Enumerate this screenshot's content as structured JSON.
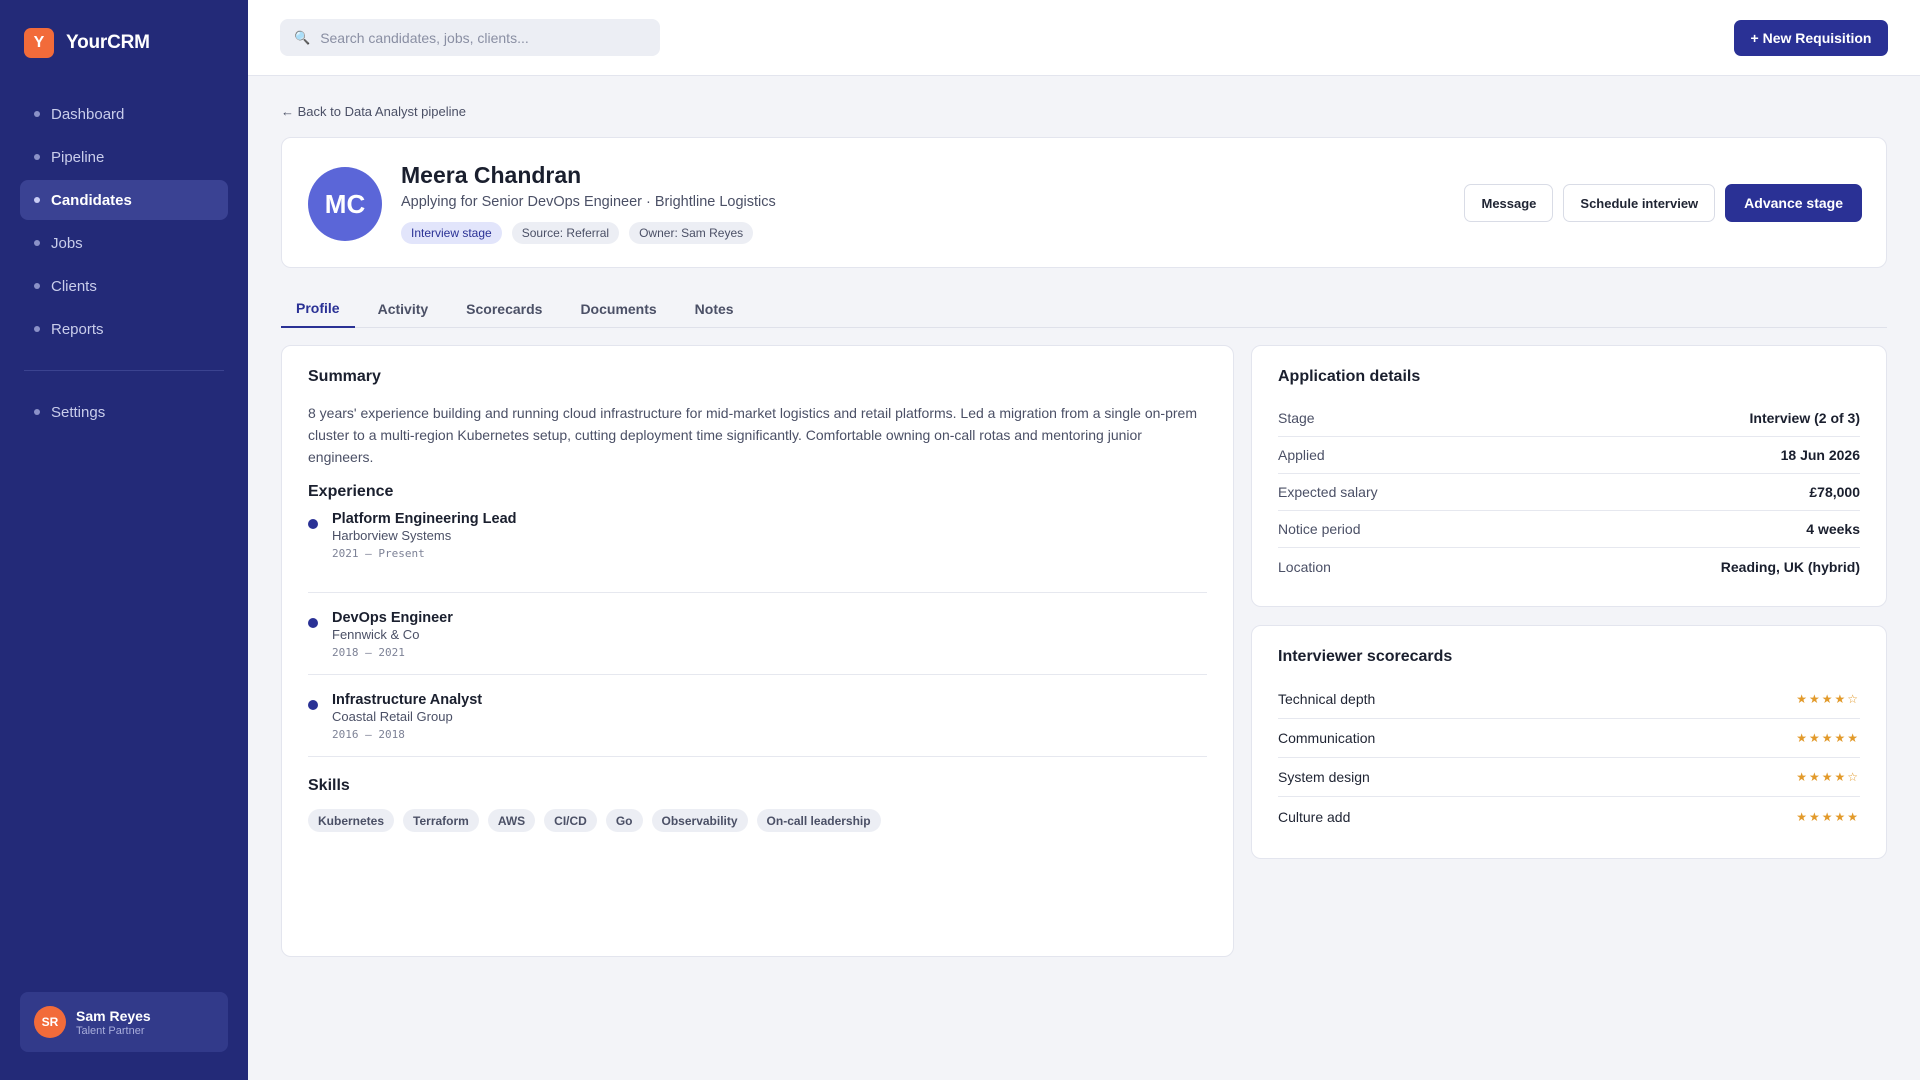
{
  "brand": {
    "logo_letter": "Y",
    "name": "YourCRM",
    "accent": "#f26b3a",
    "sidebar_bg": "#232a78"
  },
  "nav": {
    "items": [
      {
        "label": "Dashboard",
        "active": false
      },
      {
        "label": "Pipeline",
        "active": false
      },
      {
        "label": "Candidates",
        "active": true
      },
      {
        "label": "Jobs",
        "active": false
      },
      {
        "label": "Clients",
        "active": false
      },
      {
        "label": "Reports",
        "active": false
      }
    ],
    "settings": "Settings"
  },
  "user": {
    "initials": "SR",
    "name": "Sam Reyes",
    "role": "Talent Partner"
  },
  "search": {
    "placeholder": "Search candidates, jobs, clients...",
    "value": "",
    "icon": "search-icon"
  },
  "topbar": {
    "new_requisition": "+ New Requisition"
  },
  "back_link": "← Back to Data Analyst pipeline",
  "candidate": {
    "initials": "MC",
    "name": "Meera Chandran",
    "subtitle": "Applying for Senior DevOps Engineer · Brightline Logistics",
    "tags": [
      "Interview stage",
      "Source: Referral",
      "Owner: Sam Reyes"
    ]
  },
  "actions": {
    "message": "Message",
    "schedule": "Schedule interview",
    "advance": "Advance stage"
  },
  "tabs": [
    {
      "label": "Profile",
      "active": true
    },
    {
      "label": "Activity",
      "active": false
    },
    {
      "label": "Scorecards",
      "active": false
    },
    {
      "label": "Documents",
      "active": false
    },
    {
      "label": "Notes",
      "active": false
    }
  ],
  "profile": {
    "summary_title": "Summary",
    "summary": "8 years' experience building and running cloud infrastructure for mid-market logistics and retail platforms. Led a migration from a single on-prem cluster to a multi-region Kubernetes setup, cutting deployment time significantly. Comfortable owning on-call rotas and mentoring junior engineers.",
    "experience_title": "Experience",
    "experience": [
      {
        "role": "Platform Engineering Lead",
        "company": "Harborview Systems",
        "dates": "2021 — Present"
      },
      {
        "role": "DevOps Engineer",
        "company": "Fennwick & Co",
        "dates": "2018 — 2021"
      },
      {
        "role": "Infrastructure Analyst",
        "company": "Coastal Retail Group",
        "dates": "2016 — 2018"
      }
    ],
    "skills_title": "Skills",
    "skills": [
      "Kubernetes",
      "Terraform",
      "AWS",
      "CI/CD",
      "Go",
      "Observability",
      "On-call leadership"
    ]
  },
  "application": {
    "title": "Application details",
    "rows": [
      {
        "key": "Stage",
        "value": "Interview (2 of 3)"
      },
      {
        "key": "Applied",
        "value": "18 Jun 2026"
      },
      {
        "key": "Expected salary",
        "value": "£78,000"
      },
      {
        "key": "Notice period",
        "value": "4 weeks"
      },
      {
        "key": "Location",
        "value": "Reading, UK (hybrid)"
      }
    ]
  },
  "scorecards": {
    "title": "Interviewer scorecards",
    "rows": [
      {
        "label": "Technical depth",
        "stars": "★★★★☆",
        "rating": 4,
        "max": 5
      },
      {
        "label": "Communication",
        "stars": "★★★★★",
        "rating": 5,
        "max": 5
      },
      {
        "label": "System design",
        "stars": "★★★★☆",
        "rating": 4,
        "max": 5
      },
      {
        "label": "Culture add",
        "stars": "★★★★★",
        "rating": 5,
        "max": 5
      }
    ]
  }
}
